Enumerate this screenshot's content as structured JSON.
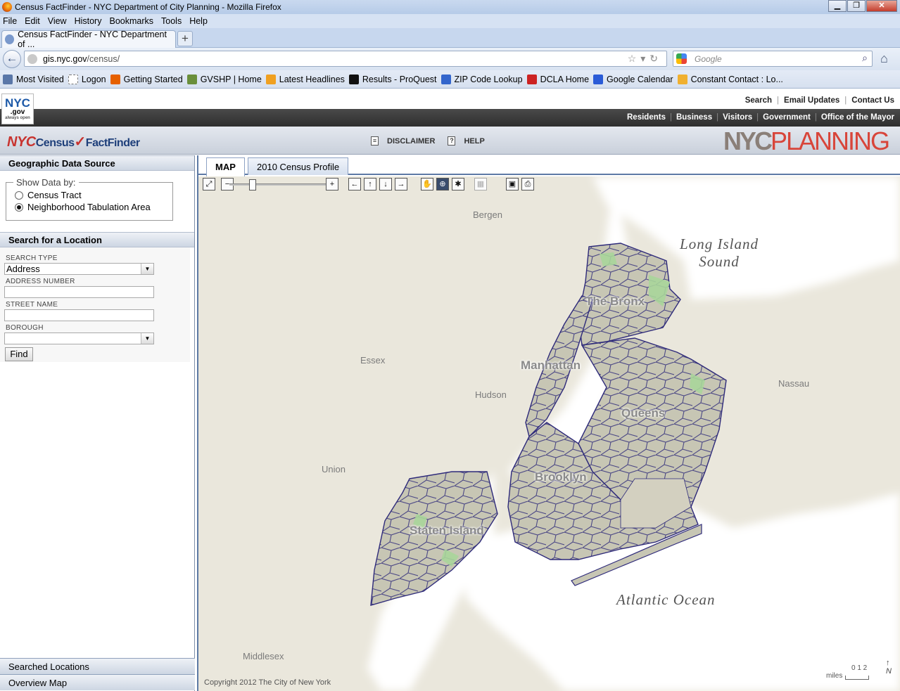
{
  "window": {
    "title": "Census FactFinder - NYC Department of City Planning - Mozilla Firefox",
    "buttons": [
      "▁",
      "❐",
      "✕"
    ]
  },
  "menu": [
    "File",
    "Edit",
    "View",
    "History",
    "Bookmarks",
    "Tools",
    "Help"
  ],
  "tab": {
    "label": "Census FactFinder - NYC Department of ...",
    "new_tab": "+"
  },
  "url": {
    "host": "gis.nyc.gov",
    "path": "/census/"
  },
  "search": {
    "placeholder": "Google"
  },
  "bookmarks": [
    {
      "label": "Most Visited",
      "color": "#5a77a8"
    },
    {
      "label": "Logon",
      "color": "#ffffff"
    },
    {
      "label": "Getting Started",
      "color": "#e66000"
    },
    {
      "label": "GVSHP | Home",
      "color": "#6a8f3b"
    },
    {
      "label": "Latest Headlines",
      "color": "#f0a020"
    },
    {
      "label": "Results - ProQuest",
      "color": "#111111"
    },
    {
      "label": "ZIP Code Lookup",
      "color": "#3366cc"
    },
    {
      "label": "DCLA Home",
      "color": "#cc2222"
    },
    {
      "label": "Google Calendar",
      "color": "#2a5bd7"
    },
    {
      "label": "Constant Contact : Lo...",
      "color": "#f0b030"
    }
  ],
  "nyc_site": {
    "logo_main": "NYC",
    "logo_sub": ".gov",
    "logo_tag": "always open",
    "top_links": [
      "Search",
      "Email Updates",
      "Contact Us"
    ],
    "nav_links": [
      "Residents",
      "Business",
      "Visitors",
      "Government",
      "Office of the Mayor"
    ]
  },
  "app": {
    "logo": {
      "nyc": "NYC",
      "census": "Census",
      "check": "✓",
      "factfinder": "FactFinder"
    },
    "disclaimer": "DISCLAIMER",
    "help": "HELP",
    "planning": {
      "nyc": "NYC",
      "planning": "PLANNING"
    }
  },
  "left_panel": {
    "geo_title": "Geographic Data Source",
    "show_data_by": "Show Data by:",
    "options": [
      {
        "label": "Census Tract",
        "selected": false
      },
      {
        "label": "Neighborhood Tabulation Area",
        "selected": true
      }
    ],
    "search_title": "Search for a Location",
    "search_type_label": "SEARCH TYPE",
    "search_type_value": "Address",
    "address_number_label": "ADDRESS NUMBER",
    "street_name_label": "STREET NAME",
    "borough_label": "BOROUGH",
    "find_button": "Find",
    "searched_locations": "Searched Locations",
    "overview_map": "Overview Map"
  },
  "map": {
    "tabs": [
      "MAP",
      "2010 Census Profile"
    ],
    "active_tab": "MAP",
    "area_labels": [
      "Bergen",
      "Essex",
      "Hudson",
      "Union",
      "Nassau",
      "Middlesex"
    ],
    "borough_labels": [
      "The Bronx",
      "Manhattan",
      "Queens",
      "Brooklyn",
      "Staten Island"
    ],
    "water_labels": {
      "lis_line1": "Long Island",
      "lis_line2": "Sound",
      "atlantic": "Atlantic Ocean"
    },
    "copyright": "Copyright 2012 The City of New York",
    "scale": {
      "ticks": "0  1  2",
      "unit": "miles"
    },
    "north": "N",
    "colors": {
      "land": "#eae7dc",
      "water": "#ffffff",
      "boro": "#c7c6b4",
      "park": "#a9d59a",
      "boundary": "#2e2a7a"
    }
  }
}
